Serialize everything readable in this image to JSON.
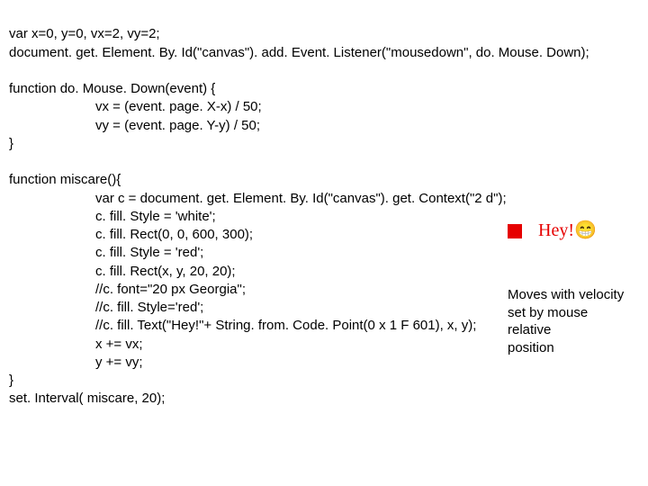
{
  "code": {
    "l01": "var x=0, y=0, vx=2, vy=2;",
    "l02": "document. get. Element. By. Id(\"canvas\"). add. Event. Listener(\"mousedown\", do. Mouse. Down);",
    "l03": "",
    "l04": "function do. Mouse. Down(event) {",
    "l05": "vx = (event. page. X-x) / 50;",
    "l06": "vy = (event. page. Y-y) / 50;",
    "l07": "}",
    "l08": "",
    "l09": "function miscare(){",
    "l10": "var c = document. get. Element. By. Id(\"canvas\"). get. Context(\"2 d\");",
    "l11": "c. fill. Style = 'white';",
    "l12": "c. fill. Rect(0, 0, 600, 300);",
    "l13": "",
    "l14": "c. fill. Style = 'red';",
    "l15": "c. fill. Rect(x, y, 20, 20);",
    "l16": "",
    "l17": "//c. font=\"20 px Georgia\";",
    "l18": "//c. fill. Style='red';",
    "l19": "//c. fill. Text(\"Hey!\"+ String. from. Code. Point(0 x 1 F 601), x, y);",
    "l20": "",
    "l21": "x += vx;",
    "l22": "y += vy;",
    "l23": "}",
    "l24": "set. Interval( miscare, 20);"
  },
  "demo": {
    "hey_text": "Hey!😁"
  },
  "annotation": {
    "line1": "Moves with velocity",
    "line2": "set by mouse relative",
    "line3": "position"
  }
}
